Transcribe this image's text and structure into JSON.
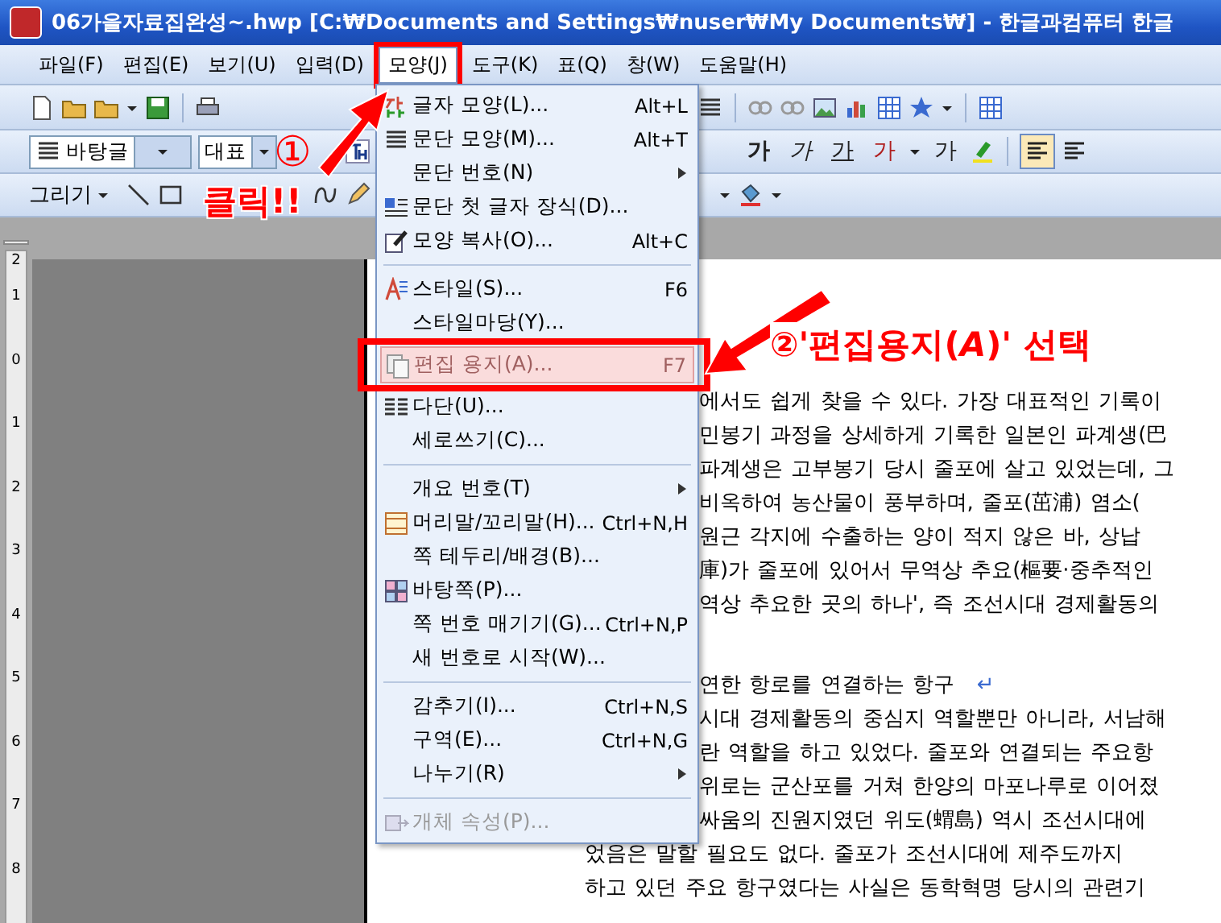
{
  "window": {
    "title": "06가을자료집완성~.hwp [C:₩Documents and Settings₩nuser₩My Documents₩] - 한글과컴퓨터 한글"
  },
  "menubar": [
    {
      "label": "파일(F)",
      "selected": false
    },
    {
      "label": "편집(E)",
      "selected": false
    },
    {
      "label": "보기(U)",
      "selected": false
    },
    {
      "label": "입력(D)",
      "selected": false
    },
    {
      "label": "모양(J)",
      "selected": true
    },
    {
      "label": "도구(K)",
      "selected": false
    },
    {
      "label": "표(Q)",
      "selected": false
    },
    {
      "label": "창(W)",
      "selected": false
    },
    {
      "label": "도움말(H)",
      "selected": false
    }
  ],
  "format_toolbar": {
    "style_select": "바탕글",
    "font_select": "대표",
    "format_buttons": [
      {
        "label": "가"
      },
      {
        "label": "가"
      },
      {
        "label": "가"
      },
      {
        "label": "가"
      },
      {
        "label": "가"
      }
    ]
  },
  "draw_toolbar": {
    "draw_menu": "그리기"
  },
  "menu": [
    {
      "kind": "item",
      "label": "글자 모양(L)...",
      "shortcut": "Alt+L",
      "submenu": false,
      "disabled": false,
      "selected": false
    },
    {
      "kind": "item",
      "label": "문단 모양(M)...",
      "shortcut": "Alt+T",
      "submenu": false,
      "disabled": false,
      "selected": false
    },
    {
      "kind": "item",
      "label": "문단 번호(N)",
      "submenu": true,
      "disabled": false,
      "selected": false
    },
    {
      "kind": "item",
      "label": "문단 첫 글자 장식(D)...",
      "submenu": false,
      "disabled": false,
      "selected": false
    },
    {
      "kind": "item",
      "label": "모양 복사(O)...",
      "shortcut": "Alt+C",
      "submenu": false,
      "disabled": false,
      "selected": false
    },
    {
      "kind": "separator"
    },
    {
      "kind": "item",
      "label": "스타일(S)...",
      "shortcut": "F6",
      "submenu": false,
      "disabled": false,
      "selected": false
    },
    {
      "kind": "item",
      "label": "스타일마당(Y)...",
      "submenu": false,
      "disabled": false,
      "selected": false
    },
    {
      "kind": "item",
      "label": "편집 용지(A)...",
      "shortcut": "F7",
      "submenu": false,
      "disabled": false,
      "selected": true
    },
    {
      "kind": "item",
      "label": "다단(U)...",
      "submenu": false,
      "disabled": false,
      "selected": false
    },
    {
      "kind": "item",
      "label": "세로쓰기(C)...",
      "submenu": false,
      "disabled": false,
      "selected": false
    },
    {
      "kind": "separator"
    },
    {
      "kind": "item",
      "label": "개요 번호(T)",
      "submenu": true,
      "disabled": false,
      "selected": false
    },
    {
      "kind": "item",
      "label": "머리말/꼬리말(H)...",
      "shortcut": "Ctrl+N,H",
      "submenu": false,
      "disabled": false,
      "selected": false
    },
    {
      "kind": "item",
      "label": "쪽 테두리/배경(B)...",
      "submenu": false,
      "disabled": false,
      "selected": false
    },
    {
      "kind": "item",
      "label": "바탕쪽(P)...",
      "submenu": false,
      "disabled": false,
      "selected": false
    },
    {
      "kind": "item",
      "label": "쪽 번호 매기기(G)...",
      "shortcut": "Ctrl+N,P",
      "submenu": false,
      "disabled": false,
      "selected": false
    },
    {
      "kind": "item",
      "label": "새 번호로 시작(W)...",
      "submenu": false,
      "disabled": false,
      "selected": false
    },
    {
      "kind": "separator"
    },
    {
      "kind": "item",
      "label": "감추기(I)...",
      "shortcut": "Ctrl+N,S",
      "submenu": false,
      "disabled": false,
      "selected": false
    },
    {
      "kind": "item",
      "label": "구역(E)...",
      "shortcut": "Ctrl+N,G",
      "submenu": false,
      "disabled": false,
      "selected": false
    },
    {
      "kind": "item",
      "label": "나누기(R)",
      "submenu": true,
      "disabled": false,
      "selected": false
    },
    {
      "kind": "separator"
    },
    {
      "kind": "item",
      "label": "개체 속성(P)...",
      "submenu": false,
      "disabled": true,
      "selected": false
    }
  ],
  "ruler": {
    "labels": [
      "2",
      "1",
      "0",
      "1",
      "2",
      "3",
      "4",
      "5",
      "6",
      "7",
      "8"
    ]
  },
  "document": {
    "lines": [
      {
        "kind": "partial",
        "text": "에서도 쉽게 찾을 수 있다. 가장 대표적인 기록이"
      },
      {
        "kind": "partial",
        "text": "민봉기 과정을 상세하게 기록한 일본인 파계생(巴"
      },
      {
        "kind": "partial",
        "text": "파계생은 고부봉기 당시 줄포에 살고 있었는데, 그"
      },
      {
        "kind": "partial",
        "text": "비옥하여 농산물이 풍부하며, 줄포(茁浦) 염소("
      },
      {
        "kind": "partial",
        "text": "원근 각지에 수출하는 양이 적지 않은 바, 상납"
      },
      {
        "kind": "partial",
        "text": "庫)가 줄포에 있어서 무역상 추요(樞要·중추적인"
      },
      {
        "kind": "partial",
        "text": "역상 추요한 곳의 하나', 즉 조선시대 경제활동의"
      },
      {
        "kind": "heading",
        "text": "연한 항로를 연결하는 항구",
        "return_mark": "↵"
      },
      {
        "kind": "partial",
        "text": "시대 경제활동의 중심지 역할뿐만 아니라, 서남해"
      },
      {
        "kind": "partial",
        "text": "란 역할을 하고 있었다. 줄포와 연결되는 주요항"
      },
      {
        "kind": "partial",
        "text": "위로는 군산포를 거쳐 한양의 마포나루로 이어졌"
      },
      {
        "kind": "partial",
        "text": "싸움의 진원지였던 위도(蝟島) 역시 조선시대에"
      },
      {
        "kind": "full",
        "text": "었음은 말할 필요도 없다. 줄포가 조선시대에 제주도까지"
      },
      {
        "kind": "full",
        "text": "하고 있던 주요 항구였다는 사실은 동학혁명 당시의 관련기"
      }
    ]
  },
  "annotations": {
    "step1_mark": "①",
    "click_label": "클릭!!",
    "step2_label": "②'편집용지(*A*)' 선택"
  }
}
